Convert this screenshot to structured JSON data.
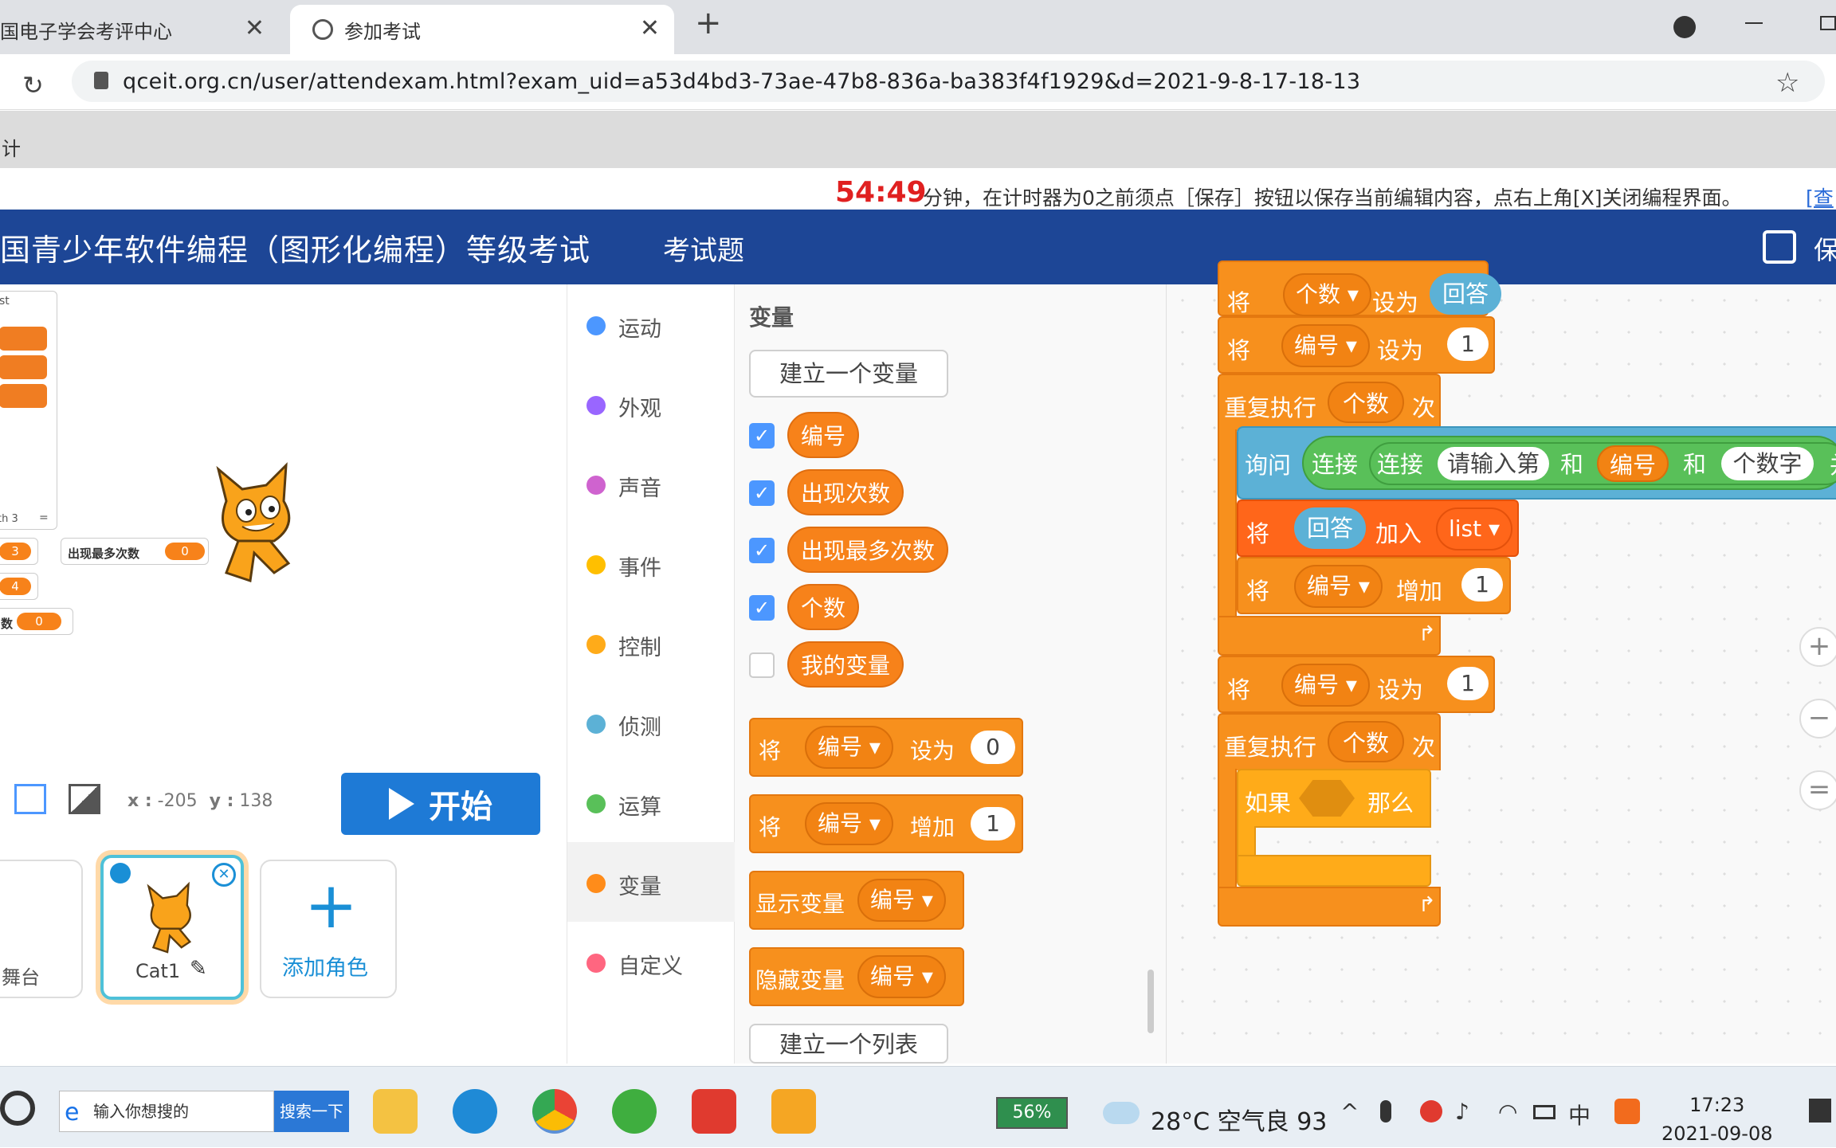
{
  "browser": {
    "tabs": [
      {
        "title": "国电子学会考评中心"
      },
      {
        "title": "参加考试"
      }
    ],
    "url": "qceit.org.cn/user/attendexam.html?exam_uid=a53d4bd3-73ae-47b8-836a-ba383f4f1929&d=2021-9-8-17-18-13",
    "bookmark_text": "计"
  },
  "notice": {
    "timer": "54:49",
    "text": "分钟，在计时器为0之前须点［保存］按钮以保存当前编辑内容，点右上角[X]关闭编程界面。",
    "link": "[查"
  },
  "header": {
    "title": "国青少年软件编程（图形化编程）等级考试",
    "tab": "考试题",
    "save": "保"
  },
  "stage": {
    "list_title": "st",
    "list_length": "th 3",
    "list_eq": "=",
    "monitors": [
      {
        "label": "出现最多次数",
        "value": "0"
      },
      {
        "label": "",
        "value": "3"
      },
      {
        "label": "",
        "value": "4"
      },
      {
        "label": "数",
        "value": "0"
      }
    ],
    "coords_x_label": "x :",
    "coords_x": "-205",
    "coords_y_label": "y :",
    "coords_y": "138",
    "start_label": "开始"
  },
  "sprites": {
    "stage_label": "舞台",
    "sprite_name": "Cat1",
    "add_label": "添加角色"
  },
  "categories": [
    {
      "label": "运动",
      "color": "#4c97ff"
    },
    {
      "label": "外观",
      "color": "#9966ff"
    },
    {
      "label": "声音",
      "color": "#cf63cf"
    },
    {
      "label": "事件",
      "color": "#ffbf00"
    },
    {
      "label": "控制",
      "color": "#ffab19"
    },
    {
      "label": "侦测",
      "color": "#5cb1d6"
    },
    {
      "label": "运算",
      "color": "#59c059"
    },
    {
      "label": "变量",
      "color": "#ff8c1a"
    },
    {
      "label": "自定义",
      "color": "#ff6680"
    }
  ],
  "palette": {
    "section": "变量",
    "make_var": "建立一个变量",
    "make_list": "建立一个列表",
    "variables": [
      {
        "name": "编号",
        "checked": true
      },
      {
        "name": "出现次数",
        "checked": true
      },
      {
        "name": "出现最多次数",
        "checked": true
      },
      {
        "name": "个数",
        "checked": true
      },
      {
        "name": "我的变量",
        "checked": false
      }
    ],
    "set_block": {
      "kw": "将",
      "var": "编号",
      "op": "设为",
      "val": "0"
    },
    "change_block": {
      "kw": "将",
      "var": "编号",
      "op": "增加",
      "val": "1"
    },
    "show_block": {
      "kw": "显示变量",
      "var": "编号"
    },
    "hide_block": {
      "kw": "隐藏变量",
      "var": "编号"
    }
  },
  "script": {
    "top_partial": {
      "kw": "将",
      "var": "个数",
      "op": "设为",
      "val": "回答"
    },
    "set1": {
      "kw": "将",
      "var": "编号",
      "op": "设为",
      "val": "1"
    },
    "repeat1": {
      "kw": "重复执行",
      "var": "个数",
      "tail": "次"
    },
    "ask": {
      "kw": "询问",
      "join1": "连接",
      "join2": "连接",
      "text1": "请输入第",
      "and1": "和",
      "var": "编号",
      "and2": "和",
      "text2": "个数字",
      "tail": "并"
    },
    "add": {
      "kw": "将",
      "val": "回答",
      "op": "加入",
      "list": "list"
    },
    "change": {
      "kw": "将",
      "var": "编号",
      "op": "增加",
      "val": "1"
    },
    "set2": {
      "kw": "将",
      "var": "编号",
      "op": "设为",
      "val": "1"
    },
    "repeat2": {
      "kw": "重复执行",
      "var": "个数",
      "tail": "次"
    },
    "if": {
      "kw": "如果",
      "then": "那么"
    }
  },
  "taskbar": {
    "search_placeholder": "输入你想搜的",
    "search_button": "搜索一下",
    "battery": "56%",
    "weather": "28°C 空气良 93",
    "ime": "中",
    "time": "17:23",
    "date": "2021-09-08"
  }
}
